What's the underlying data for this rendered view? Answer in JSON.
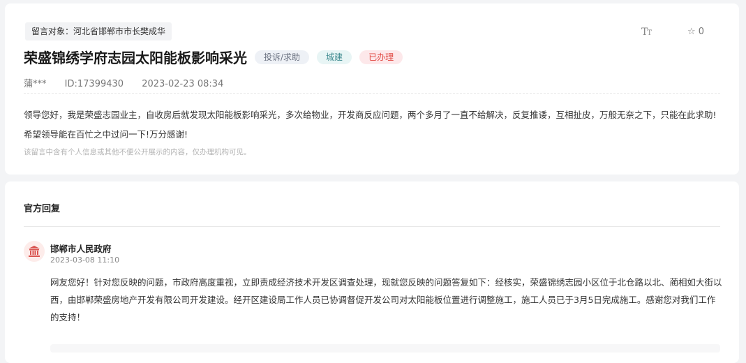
{
  "message": {
    "target_label": "留言对象：",
    "target_value": "河北省邯郸市市长樊成华",
    "title": "荣盛锦绣学府志园太阳能板影响采光",
    "tags": {
      "type": "投诉/求助",
      "category": "城建",
      "status": "已办理"
    },
    "author": "蒲***",
    "id": "ID:17399430",
    "datetime": "2023-02-23 08:34",
    "body": "领导您好，我是荣盛志园业主，自收房后就发现太阳能板影响采光，多次给物业，开发商反应问题，两个多月了一直不给解决，反复推诿，互相扯皮，万般无奈之下，只能在此求助!希望领导能在百忙之中过问一下!万分感谢!",
    "privacy_note": "该留言中含有个人信息或其他不便公开展示的内容，仅办理机构可见。",
    "toolbar": {
      "font_icon": "font-size-icon",
      "star_icon": "star-icon",
      "star_count": "0"
    }
  },
  "reply": {
    "heading": "官方回复",
    "org_name": "邯郸市人民政府",
    "org_icon": "government-building-icon",
    "datetime": "2023-03-08 11:10",
    "body": "网友您好！针对您反映的问题，市政府高度重视，立即责成经济技术开发区调查处理，现就您反映的问题答复如下：经核实，荣盛锦绣志园小区位于北仓路以北、蔺相如大街以西，由邯郸荣盛房地产开发有限公司开发建设。经开区建设局工作人员已协调督促开发公司对太阳能板位置进行调整施工，施工人员已于3月5日完成施工。感谢您对我们工作的支持！"
  },
  "colors": {
    "page_bg": "#f3f4f6",
    "status_red": "#e0463f",
    "category_teal": "#3f8a8f",
    "avatar_red": "#d9534f"
  }
}
